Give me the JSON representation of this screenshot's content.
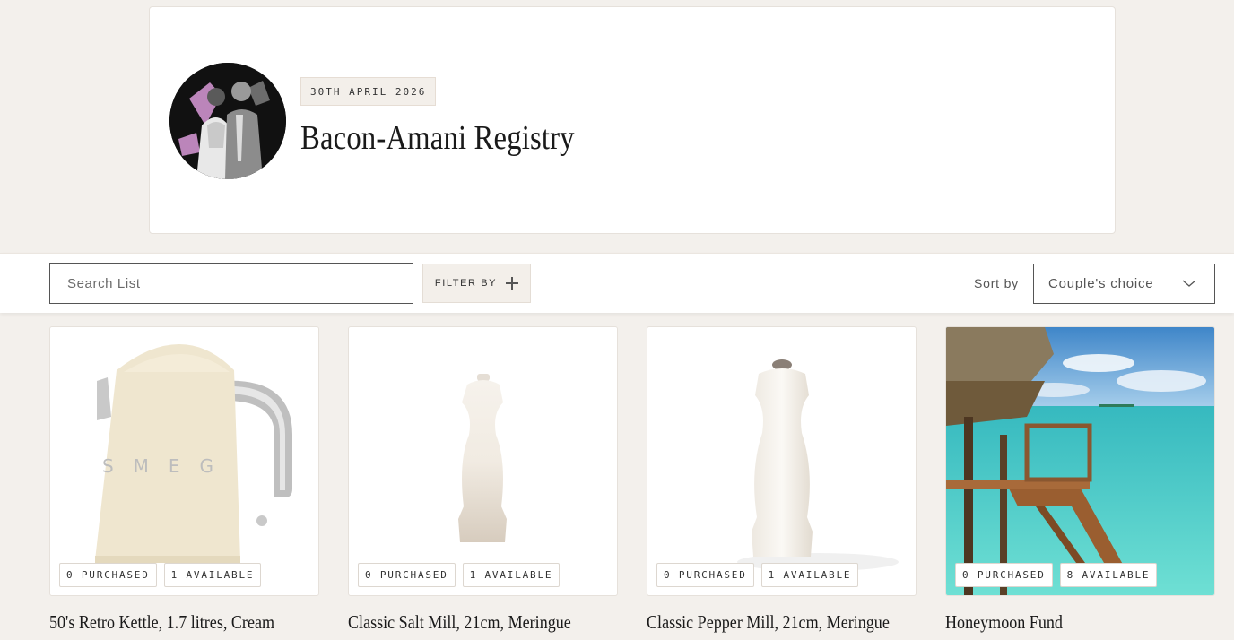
{
  "registry": {
    "date": "30TH APRIL 2026",
    "title": "Bacon-Amani Registry"
  },
  "toolbar": {
    "search_placeholder": "Search List",
    "filter_label": "FILTER BY",
    "sort_label": "Sort by",
    "sort_value": "Couple's choice"
  },
  "products": [
    {
      "name": "50's Retro Kettle, 1.7 litres, Cream",
      "purchased": "0 PURCHASED",
      "available": "1 AVAILABLE"
    },
    {
      "name": "Classic Salt Mill, 21cm, Meringue",
      "purchased": "0 PURCHASED",
      "available": "1 AVAILABLE"
    },
    {
      "name": "Classic Pepper Mill, 21cm, Meringue",
      "purchased": "0 PURCHASED",
      "available": "1 AVAILABLE"
    },
    {
      "name": "Honeymoon Fund",
      "purchased": "0 PURCHASED",
      "available": "8 AVAILABLE"
    }
  ],
  "icons": [
    "plus-icon",
    "chevron-down-icon"
  ]
}
